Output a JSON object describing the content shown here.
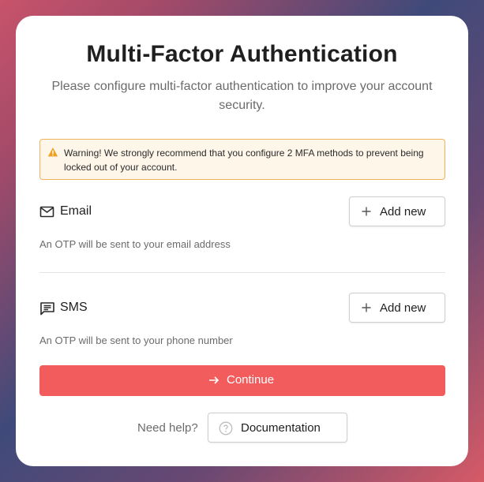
{
  "dialog": {
    "title": "Multi-Factor Authentication",
    "subtitle": "Please configure multi-factor authentication to improve your account security."
  },
  "warning": {
    "icon": "warning-icon",
    "text": "Warning! We strongly recommend that you configure 2 MFA methods to prevent being locked out of your account."
  },
  "methods": [
    {
      "icon": "mail-icon",
      "label": "Email",
      "button_label": "Add new",
      "description": "An OTP will be sent to your email address"
    },
    {
      "icon": "message-icon",
      "label": "SMS",
      "button_label": "Add new",
      "description": "An OTP will be sent to your phone number"
    }
  ],
  "actions": {
    "continue_label": "Continue",
    "help_text": "Need help?",
    "documentation_label": "Documentation"
  },
  "colors": {
    "primary": "#f25c5c",
    "warning_border": "#f0b25a",
    "warning_background": "#fff6ea",
    "warning_icon": "#f0a020"
  }
}
